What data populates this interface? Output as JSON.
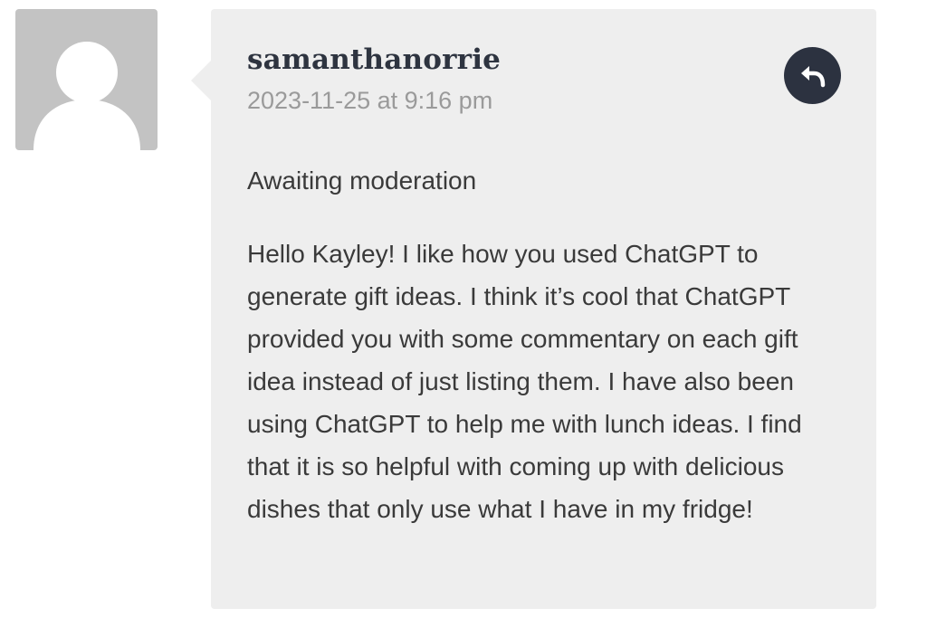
{
  "comment": {
    "author": "samanthanorrie",
    "timestamp": "2023-11-25 at 9:16 pm",
    "moderation_status": "Awaiting moderation",
    "body": "Hello Kayley! I like how you used ChatGPT to generate gift ideas. I think it’s cool that ChatGPT provided you with some commentary on each gift idea instead of just listing them. I have also been using ChatGPT to help me with lunch ideas. I find that it is so helpful with coming up with delicious dishes that only use what I have in my fridge!"
  },
  "icons": {
    "avatar": "default-avatar-icon",
    "reply": "reply-arrow-icon"
  },
  "colors": {
    "avatar_bg": "#c3c3c3",
    "bubble_bg": "#eeeeee",
    "reply_button_bg": "#2c3240",
    "author": "#2e3440",
    "timestamp": "#9a9a9a",
    "text": "#3a3a3a"
  }
}
